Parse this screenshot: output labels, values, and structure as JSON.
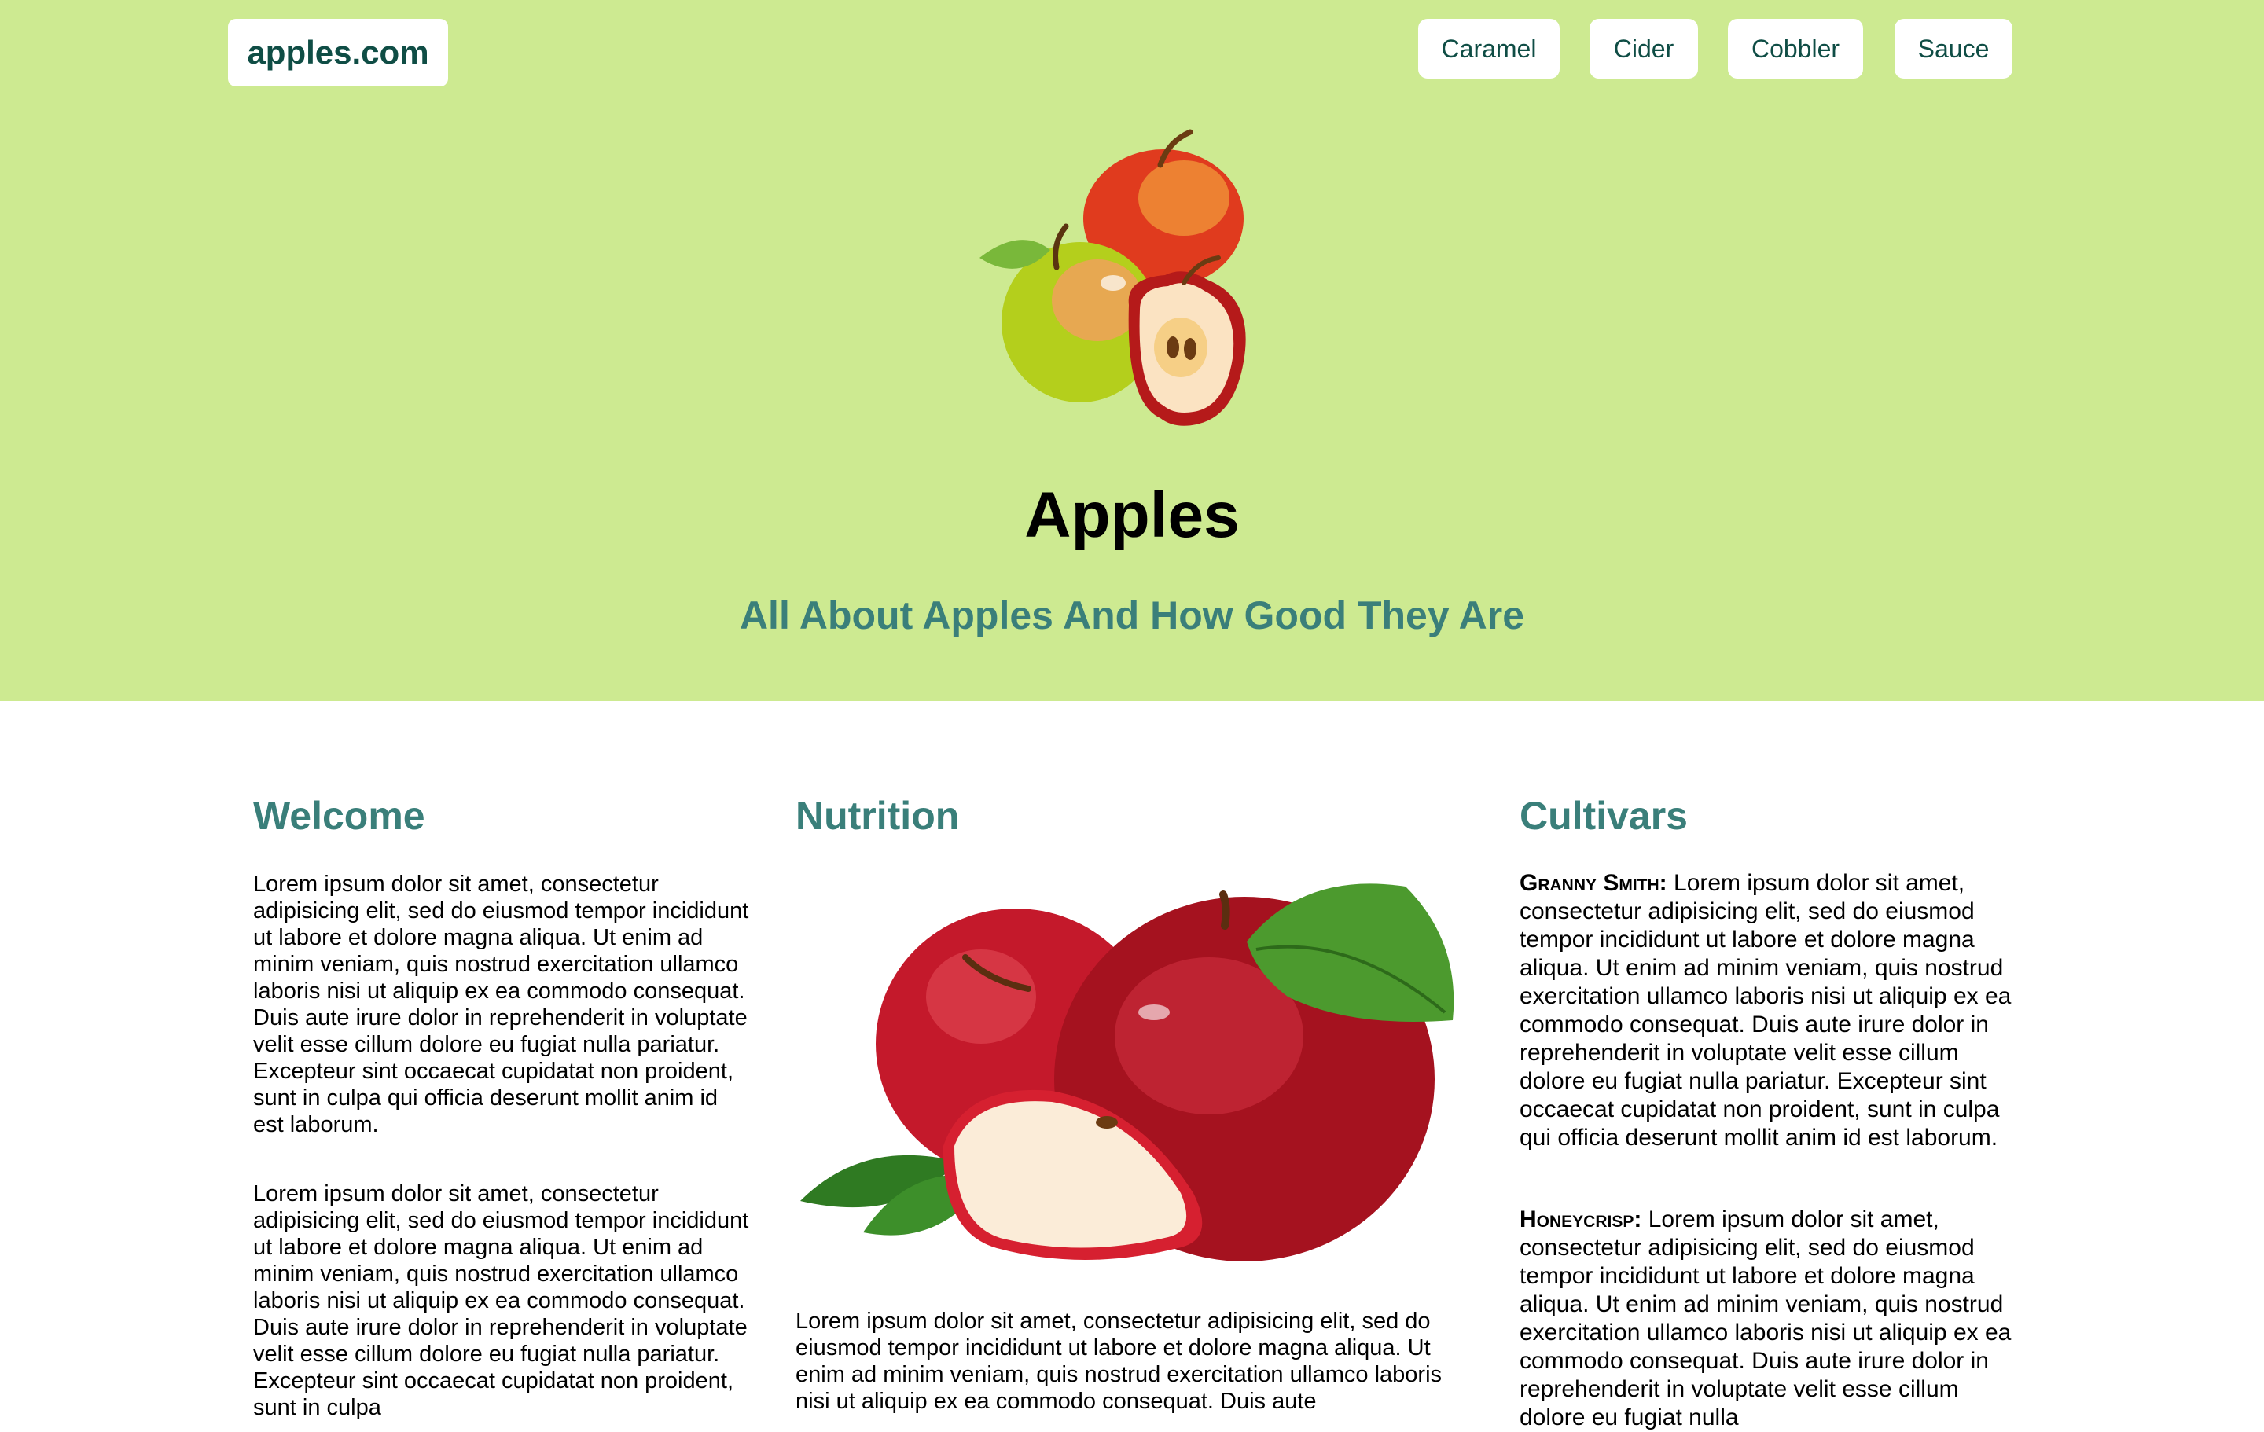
{
  "header": {
    "logo_text": "apples.com",
    "nav": [
      "Caramel",
      "Cider",
      "Cobbler",
      "Sauce"
    ]
  },
  "hero": {
    "title": "Apples",
    "subtitle": "All About Apples And How Good They Are"
  },
  "welcome": {
    "heading": "Welcome",
    "paragraphs": [
      "Lorem ipsum dolor sit amet, consectetur adipisicing elit, sed do eiusmod tempor incididunt ut labore et dolore magna aliqua. Ut enim ad minim veniam, quis nostrud exercitation ullamco laboris nisi ut aliquip ex ea commodo consequat. Duis aute irure dolor in reprehenderit in voluptate velit esse cillum dolore eu fugiat nulla pariatur. Excepteur sint occaecat cupidatat non proident, sunt in culpa qui officia deserunt mollit anim id est laborum.",
      "Lorem ipsum dolor sit amet, consectetur adipisicing elit, sed do eiusmod tempor incididunt ut labore et dolore magna aliqua. Ut enim ad minim veniam, quis nostrud exercitation ullamco laboris nisi ut aliquip ex ea commodo consequat. Duis aute irure dolor in reprehenderit in voluptate velit esse cillum dolore eu fugiat nulla pariatur. Excepteur sint occaecat cupidatat non proident, sunt in culpa"
    ]
  },
  "nutrition": {
    "heading": "Nutrition",
    "text": "Lorem ipsum dolor sit amet, consectetur adipisicing elit, sed do eiusmod tempor incididunt ut labore et dolore magna aliqua. Ut enim ad minim veniam, quis nostrud exercitation ullamco laboris nisi ut aliquip ex ea commodo consequat. Duis aute"
  },
  "cultivars": {
    "heading": "Cultivars",
    "items": [
      {
        "name": "Granny Smith:",
        "text": " Lorem ipsum dolor sit amet, consectetur adipisicing elit, sed do eiusmod tempor incididunt ut labore et dolore magna aliqua. Ut enim ad minim veniam, quis nostrud exercitation ullamco laboris nisi ut aliquip ex ea commodo consequat. Duis aute irure dolor in reprehenderit in voluptate velit esse cillum dolore eu fugiat nulla pariatur. Excepteur sint occaecat cupidatat non proident, sunt in culpa qui officia deserunt mollit anim id est laborum."
      },
      {
        "name": "Honeycrisp:",
        "text": " Lorem ipsum dolor sit amet, consectetur adipisicing elit, sed do eiusmod tempor incididunt ut labore et dolore magna aliqua. Ut enim ad minim veniam, quis nostrud exercitation ullamco laboris nisi ut aliquip ex ea commodo consequat. Duis aute irure dolor in reprehenderit in voluptate velit esse cillum dolore eu fugiat nulla"
      }
    ]
  },
  "colors": {
    "hero_bg": "#cdea91",
    "accent_teal": "#3a7f7a",
    "logo_text": "#0f4d45",
    "page_bg": "#ffffff"
  }
}
